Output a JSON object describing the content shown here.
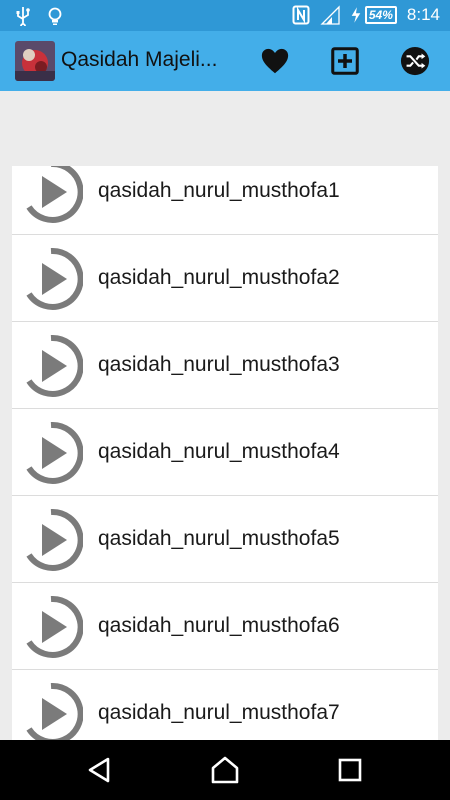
{
  "status_bar": {
    "time": "8:14",
    "battery_percent": "54%",
    "icons": [
      "usb-icon",
      "lightbulb-icon",
      "nfc-icon",
      "signal-icon",
      "charging-icon",
      "battery-icon"
    ]
  },
  "app_bar": {
    "title": "Qasidah Majeli...",
    "actions": [
      "heart-icon",
      "add-box-icon",
      "shuffle-icon"
    ],
    "colors": {
      "status": "#2f98d6",
      "bar": "#43aee9"
    }
  },
  "tracks": [
    "qasidah_nurul_musthofa1",
    "qasidah_nurul_musthofa2",
    "qasidah_nurul_musthofa3",
    "qasidah_nurul_musthofa4",
    "qasidah_nurul_musthofa5",
    "qasidah_nurul_musthofa6",
    "qasidah_nurul_musthofa7"
  ],
  "nav_bar": {
    "buttons": [
      "back-icon",
      "home-icon",
      "recents-icon"
    ]
  }
}
